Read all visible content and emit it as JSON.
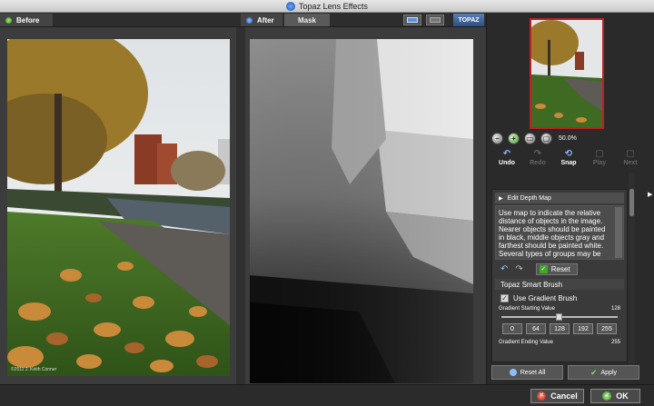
{
  "window": {
    "title": "Topaz Lens Effects"
  },
  "tabs": {
    "before": "Before",
    "after": "After",
    "mask": "Mask"
  },
  "brand": {
    "logo_text": "TOPAZ"
  },
  "photo": {
    "copyright": "©2011 J. Keith Conner"
  },
  "zoom": {
    "value": "50.0%",
    "icons": [
      "zoom-out-icon",
      "zoom-in-icon",
      "fit-icon",
      "actual-size-icon"
    ]
  },
  "actions": [
    {
      "label": "Undo",
      "enabled": true
    },
    {
      "label": "Redo",
      "enabled": false
    },
    {
      "label": "Snap",
      "enabled": true
    },
    {
      "label": "Play",
      "enabled": false
    },
    {
      "label": "Next",
      "enabled": false
    }
  ],
  "depth_map": {
    "title": "Edit Depth Map",
    "description": "Use map to indicate the relative distance of objects in the image. Nearer objects should be painted in black, middle objects gray and farthest should be painted white. Several types of groups may be",
    "reset_label": "Reset"
  },
  "smart_brush": {
    "title": "Topaz Smart Brush",
    "use_gradient_label": "Use Gradient Brush",
    "use_gradient_checked": true,
    "start_label": "Gradient Starting Value",
    "start_value": "128",
    "start_fraction": 0.5,
    "presets": [
      "0",
      "64",
      "128",
      "192",
      "255"
    ],
    "end_label": "Gradient Ending Value",
    "end_value": "255"
  },
  "panel_buttons": {
    "reset_all": "Reset All",
    "apply": "Apply"
  },
  "footer": {
    "cancel": "Cancel",
    "ok": "OK"
  },
  "colors": {
    "accent_red": "#c02020",
    "ok_green": "#3fa82a",
    "tab_blue": "#2059b8"
  }
}
